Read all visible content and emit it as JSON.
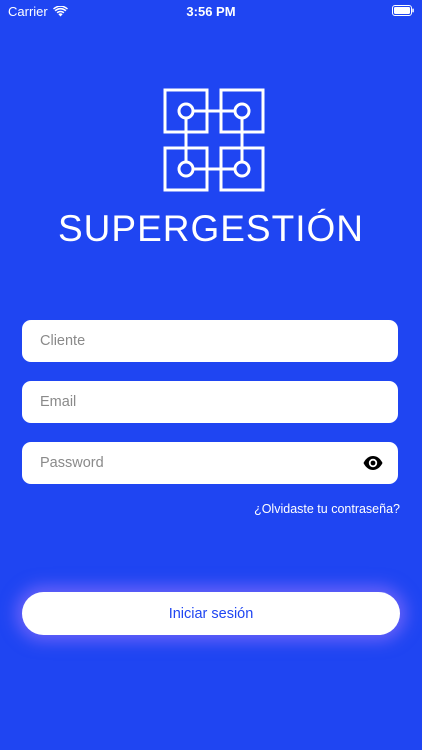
{
  "status_bar": {
    "carrier": "Carrier",
    "time": "3:56 PM"
  },
  "brand": {
    "name": "SUPERGESTIÓN"
  },
  "form": {
    "cliente_placeholder": "Cliente",
    "email_placeholder": "Email",
    "password_placeholder": "Password",
    "forgot_password": "¿Olvidaste tu contraseña?",
    "login_label": "Iniciar sesión"
  },
  "colors": {
    "background": "#1f45f2",
    "button_text": "#1f45f2",
    "glow": "#a578ff"
  }
}
